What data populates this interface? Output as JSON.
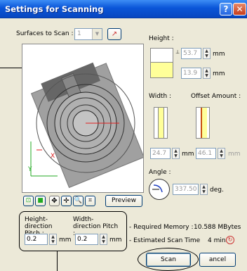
{
  "window": {
    "title": "Settings for Scanning"
  },
  "surfaces": {
    "label": "Surfaces to Scan :",
    "value": "1"
  },
  "height": {
    "label": "Height :",
    "top_value": "53.7",
    "bottom_value": "13.9",
    "unit": "mm"
  },
  "width": {
    "label": "Width :",
    "value": "24.7",
    "unit": "mm"
  },
  "offset": {
    "label": "Offset Amount :",
    "value": "46.1",
    "unit": "mm"
  },
  "angle": {
    "label": "Angle :",
    "value": "337.50",
    "unit": "deg."
  },
  "preview": {
    "axis_x": "X",
    "axis_y": "Y",
    "button_label": "Preview"
  },
  "pitch": {
    "height_label": "Height-direction Pitch :",
    "height_value": "0.2",
    "width_label": "Width-direction Pitch :",
    "width_value": "0.2",
    "unit": "mm"
  },
  "memory": {
    "label": "- Required Memory :",
    "value": "10.588 MBytes"
  },
  "scan_time": {
    "label": "- Estimated Scan Time",
    "value": "4 min."
  },
  "buttons": {
    "scan": "Scan",
    "cancel": "ancel"
  },
  "colors": {
    "title_bar": "#0a55d8",
    "window_bg": "#ece9d8",
    "highlight": "#ffff99",
    "preview_gray": "#a0a0a0"
  }
}
